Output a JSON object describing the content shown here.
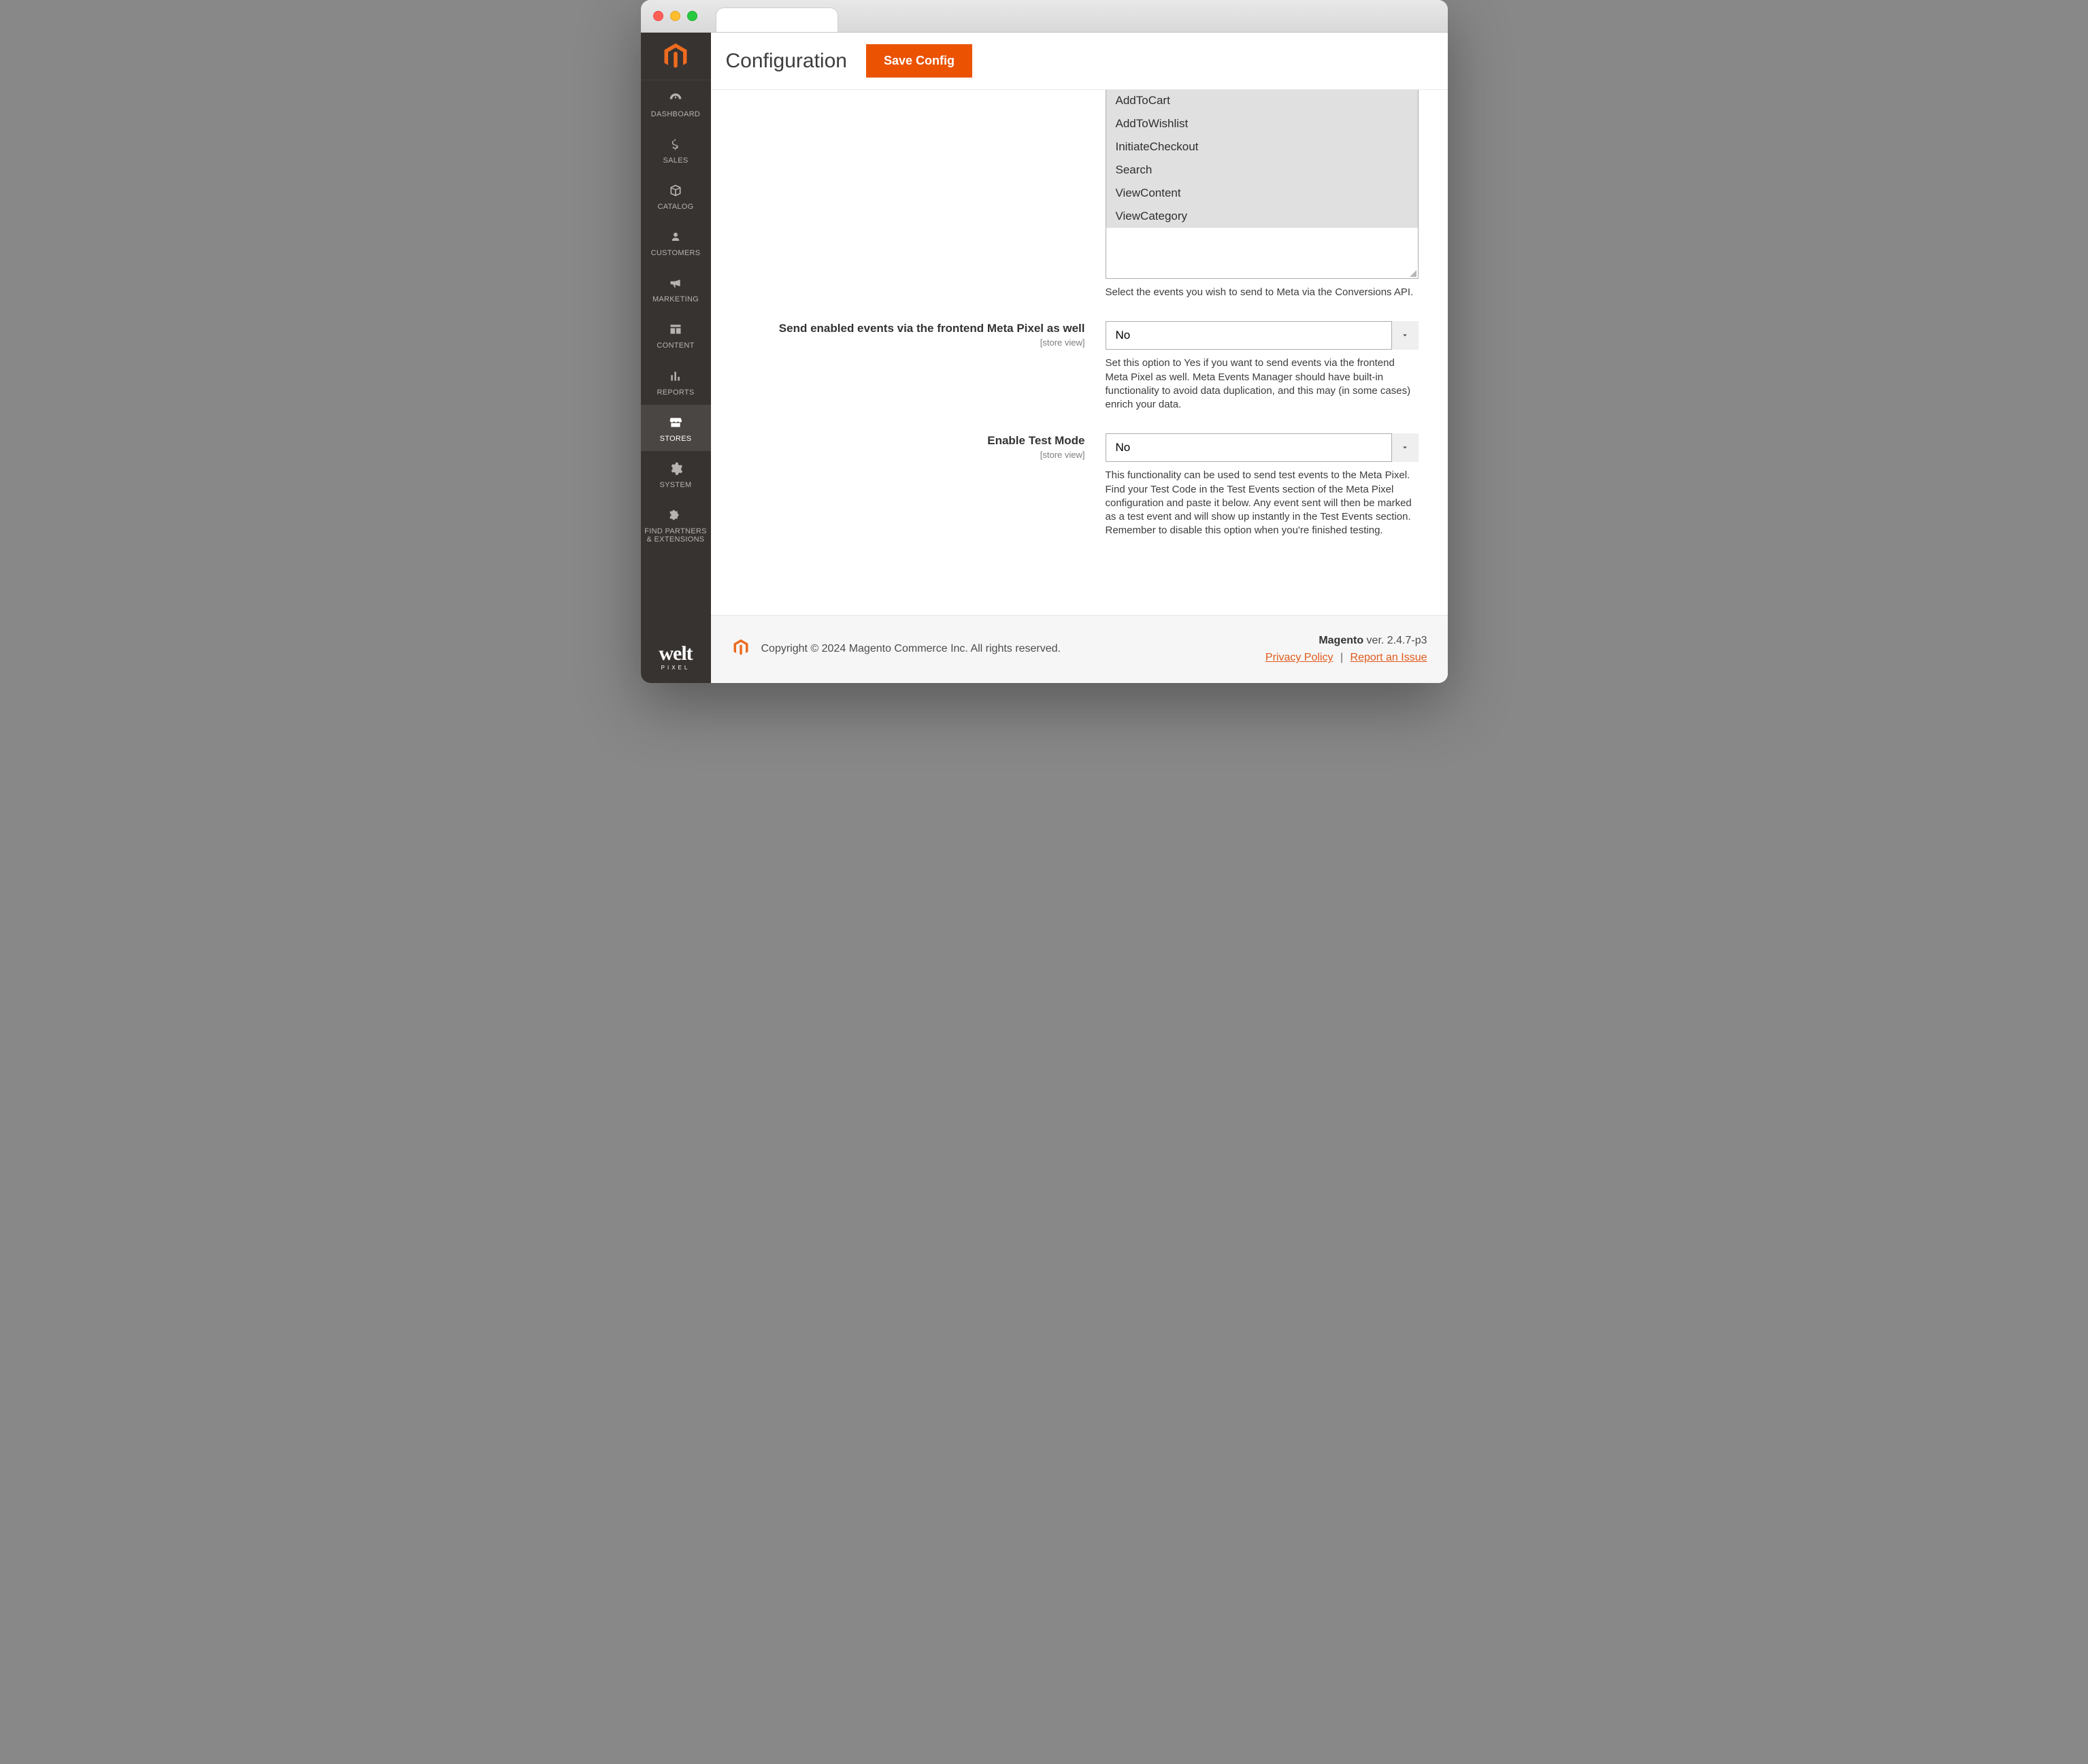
{
  "header": {
    "page_title": "Configuration",
    "save_button": "Save Config"
  },
  "sidebar": {
    "items": [
      {
        "id": "dashboard",
        "label": "DASHBOARD"
      },
      {
        "id": "sales",
        "label": "SALES"
      },
      {
        "id": "catalog",
        "label": "CATALOG"
      },
      {
        "id": "customers",
        "label": "CUSTOMERS"
      },
      {
        "id": "marketing",
        "label": "MARKETING"
      },
      {
        "id": "content",
        "label": "CONTENT"
      },
      {
        "id": "reports",
        "label": "REPORTS"
      },
      {
        "id": "stores",
        "label": "STORES",
        "selected": true
      },
      {
        "id": "system",
        "label": "SYSTEM"
      },
      {
        "id": "partners",
        "label": "FIND PARTNERS & EXTENSIONS"
      }
    ]
  },
  "bottom_brand": {
    "line1": "welt",
    "line2": "PIXEL"
  },
  "config": {
    "events_multiselect": {
      "options": [
        "AddToCart",
        "AddToWishlist",
        "InitiateCheckout",
        "Search",
        "ViewContent",
        "ViewCategory"
      ],
      "note": "Select the events you wish to send to Meta via the Conversions API."
    },
    "send_via_pixel": {
      "label": "Send enabled events via the frontend Meta Pixel as well",
      "scope": "[store view]",
      "value": "No",
      "help": "Set this option to Yes if you want to send events via the frontend Meta Pixel as well. Meta Events Manager should have built-in functionality to avoid data duplication, and this may (in some cases) enrich your data."
    },
    "enable_test_mode": {
      "label": "Enable Test Mode",
      "scope": "[store view]",
      "value": "No",
      "help": "This functionality can be used to send test events to the Meta Pixel. Find your Test Code in the Test Events section of the Meta Pixel configuration and paste it below. Any event sent will then be marked as a test event and will show up instantly in the Test Events section. Remember to disable this option when you're finished testing."
    }
  },
  "footer": {
    "copyright": "Copyright © 2024 Magento Commerce Inc. All rights reserved.",
    "product": "Magento",
    "version_prefix": " ver. ",
    "version": "2.4.7-p3",
    "privacy_policy": "Privacy Policy",
    "separator": "|",
    "report_issue": "Report an Issue"
  }
}
